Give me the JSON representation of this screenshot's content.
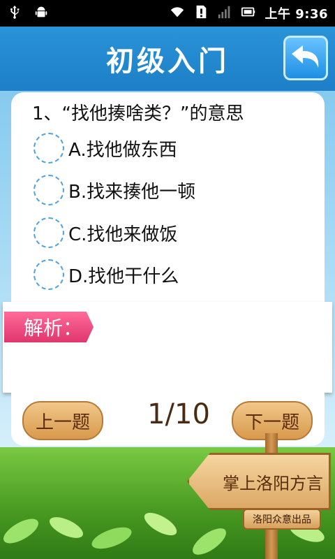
{
  "status_bar": {
    "time": "9:36",
    "ampm": "上午",
    "icons": [
      "usb-icon",
      "android-debug-icon",
      "wifi-icon",
      "alert-icon",
      "signal-icon",
      "battery-icon"
    ]
  },
  "header": {
    "title": "初级入门",
    "back_icon": "back-arrow-icon"
  },
  "question": {
    "text": "1、“找他揍啥类？”的意思",
    "options": [
      {
        "label": "A.找他做东西"
      },
      {
        "label": "B.找来揍他一顿"
      },
      {
        "label": "C.找他来做饭"
      },
      {
        "label": "D.找他干什么"
      }
    ]
  },
  "analysis": {
    "label": "解析："
  },
  "nav": {
    "prev_label": "上一题",
    "next_label": "下一题",
    "page": "1/10"
  },
  "sign": {
    "title": "掌上洛阳方言",
    "subtitle": "洛阳众意出品"
  },
  "colors": {
    "header_blue": "#1d7fc7",
    "tab_pink": "#e0366e",
    "wood": "#d89a4d"
  }
}
